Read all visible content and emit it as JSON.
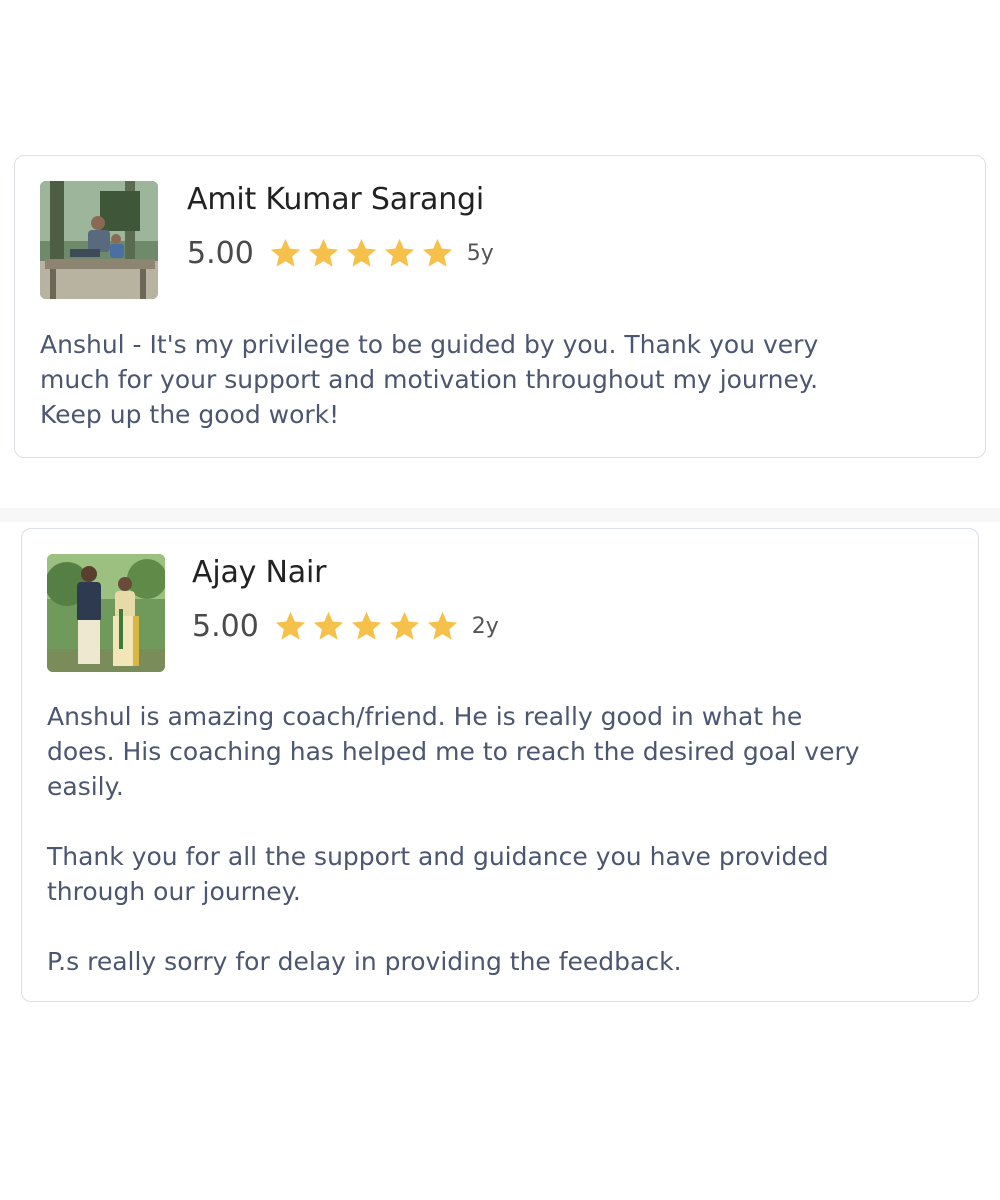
{
  "colors": {
    "star": "#F5C14A",
    "name_text": "#222222",
    "review_text": "#4C5670",
    "card_border": "#DCDFE4"
  },
  "reviews": [
    {
      "name": "Amit Kumar Sarangi",
      "rating": "5.00",
      "stars": 5,
      "age": "5y",
      "avatar": "reviewer-photo",
      "text_lines": [
        "Anshul - It's my privilege to be guided by you. Thank you very",
        "much for your support and motivation throughout my journey.",
        "Keep up the good work!"
      ]
    },
    {
      "name": "Ajay Nair",
      "rating": "5.00",
      "stars": 5,
      "age": "2y",
      "avatar": "reviewer-photo",
      "text_lines": [
        "Anshul is amazing coach/friend. He is really good in what he",
        "does. His coaching has helped me to reach the desired goal very",
        "easily.",
        "",
        "Thank you for all the support and guidance you have provided",
        "through our journey.",
        "",
        "P.s really sorry for delay in providing the feedback."
      ]
    }
  ]
}
